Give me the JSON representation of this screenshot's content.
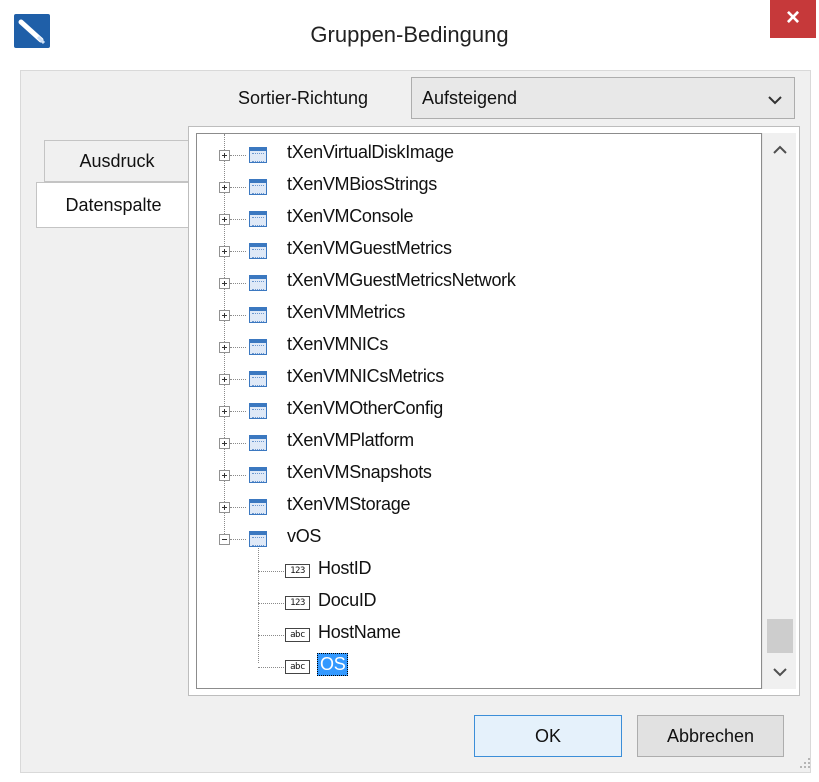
{
  "window": {
    "title": "Gruppen-Bedingung",
    "close_label": "×"
  },
  "sort": {
    "label": "Sortier-Richtung",
    "value": "Aufsteigend"
  },
  "tabs": [
    {
      "label": "Ausdruck"
    },
    {
      "label": "Datenspalte"
    }
  ],
  "tree": {
    "tables": [
      {
        "label": "tXenVirtualDiskImage"
      },
      {
        "label": "tXenVMBiosStrings"
      },
      {
        "label": "tXenVMConsole"
      },
      {
        "label": "tXenVMGuestMetrics"
      },
      {
        "label": "tXenVMGuestMetricsNetwork"
      },
      {
        "label": "tXenVMMetrics"
      },
      {
        "label": "tXenVMNICs"
      },
      {
        "label": "tXenVMNICsMetrics"
      },
      {
        "label": "tXenVMOtherConfig"
      },
      {
        "label": "tXenVMPlatform"
      },
      {
        "label": "tXenVMSnapshots"
      },
      {
        "label": "tXenVMStorage"
      },
      {
        "label": "vOS"
      }
    ],
    "fields": [
      {
        "label": "HostID",
        "type_icon": "123"
      },
      {
        "label": "DocuID",
        "type_icon": "123"
      },
      {
        "label": "HostName",
        "type_icon": "abc"
      },
      {
        "label": "OS",
        "type_icon": "abc"
      }
    ]
  },
  "buttons": {
    "ok": "OK",
    "cancel": "Abbrechen"
  },
  "colors": {
    "selection": "#3399ff",
    "close": "#c6393a",
    "accent": "#1f5fa8"
  }
}
